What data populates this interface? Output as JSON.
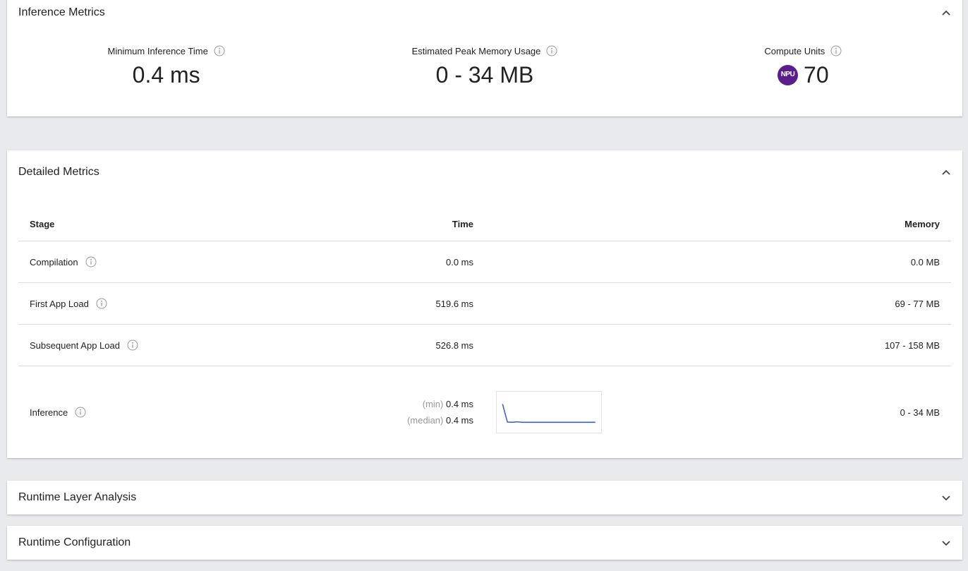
{
  "inference_metrics": {
    "title": "Inference Metrics",
    "metrics": [
      {
        "label": "Minimum Inference Time",
        "value": "0.4 ms"
      },
      {
        "label": "Estimated Peak Memory Usage",
        "value": "0 - 34 MB"
      },
      {
        "label": "Compute Units",
        "badge": "NPU",
        "value": "70"
      }
    ]
  },
  "detailed_metrics": {
    "title": "Detailed Metrics",
    "columns": {
      "stage": "Stage",
      "time": "Time",
      "memory": "Memory"
    },
    "rows": [
      {
        "stage": "Compilation",
        "time": "0.0 ms",
        "memory": "0.0 MB"
      },
      {
        "stage": "First App Load",
        "time": "519.6 ms",
        "memory": "69 - 77 MB"
      },
      {
        "stage": "Subsequent App Load",
        "time": "526.8 ms",
        "memory": "107 - 158 MB"
      }
    ],
    "inference": {
      "stage": "Inference",
      "min_label": "(min)",
      "min_value": "0.4 ms",
      "median_label": "(median)",
      "median_value": "0.4 ms",
      "memory": "0 - 34 MB",
      "sparkline": [
        2.6,
        0.45,
        0.42,
        0.48,
        0.42,
        0.42,
        0.42,
        0.42,
        0.42,
        0.42,
        0.42,
        0.42,
        0.42,
        0.42,
        0.42,
        0.42,
        0.42,
        0.42,
        0.42,
        0.42
      ]
    }
  },
  "runtime_layer_analysis": {
    "title": "Runtime Layer Analysis"
  },
  "runtime_configuration": {
    "title": "Runtime Configuration"
  },
  "colors": {
    "accent_npu": "#5a1d8c",
    "sparkline": "#3b5bdb",
    "page_bg": "#e9eaed"
  },
  "icons": {
    "info": "info-icon",
    "collapse": "chevron-up-icon",
    "expand": "chevron-down-icon"
  }
}
